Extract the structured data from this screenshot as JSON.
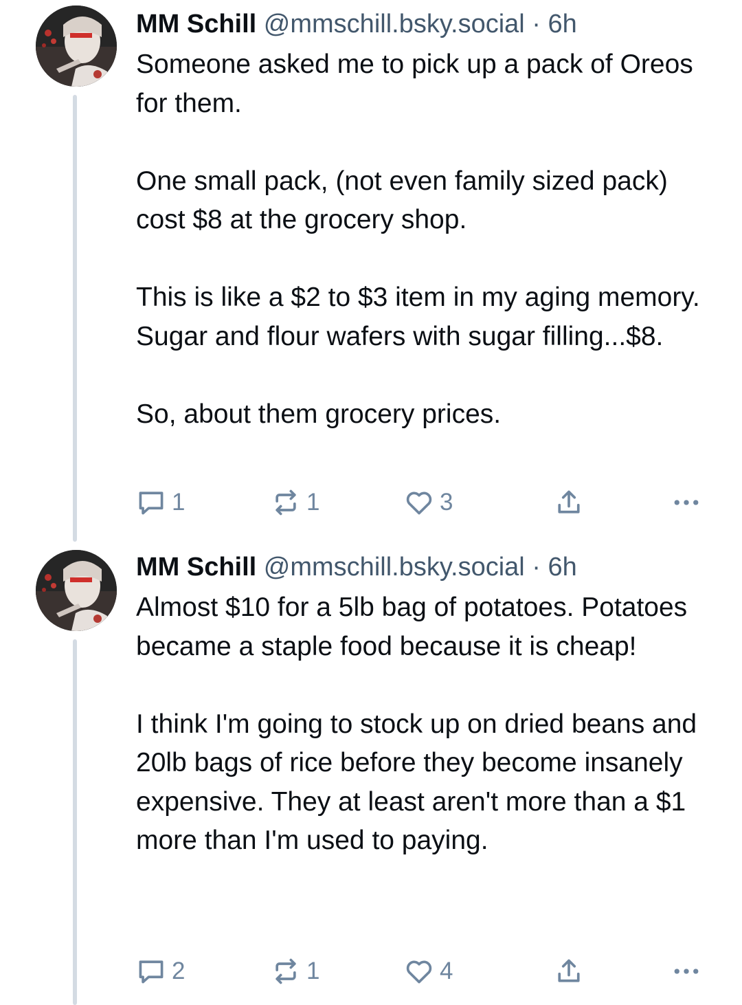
{
  "posts": [
    {
      "author": {
        "name": "MM Schill",
        "handle": "@mmschill.bsky.social",
        "separator": "·",
        "time": "6h"
      },
      "paragraphs": [
        "Someone asked me to pick up a pack of Oreos for them.",
        "One small pack, (not even family sized pack) cost $8 at the grocery shop.",
        "This is like a $2 to $3 item in my aging memory. Sugar and flour wafers with sugar filling...$8.",
        "So, about them grocery prices."
      ],
      "counts": {
        "replies": "1",
        "reposts": "1",
        "likes": "3"
      }
    },
    {
      "author": {
        "name": "MM Schill",
        "handle": "@mmschill.bsky.social",
        "separator": "·",
        "time": "6h"
      },
      "paragraphs": [
        "Almost $10 for a 5lb bag of potatoes. Potatoes became a staple food because it is cheap!",
        "I think I'm going to stock up on dried beans and 20lb bags of rice before they become insanely expensive. They at least aren't more than a $1 more than I'm used to paying."
      ],
      "counts": {
        "replies": "2",
        "reposts": "1",
        "likes": "4"
      }
    }
  ],
  "icons": {
    "reply": "speech-bubble-icon",
    "repost": "repost-arrows-icon",
    "like": "heart-icon",
    "share": "share-upload-icon",
    "more": "ellipsis-icon"
  },
  "colors": {
    "text": "#0b0f14",
    "muted": "#42576c",
    "icon": "#6f869f",
    "thread_line": "#d4dbe3"
  }
}
